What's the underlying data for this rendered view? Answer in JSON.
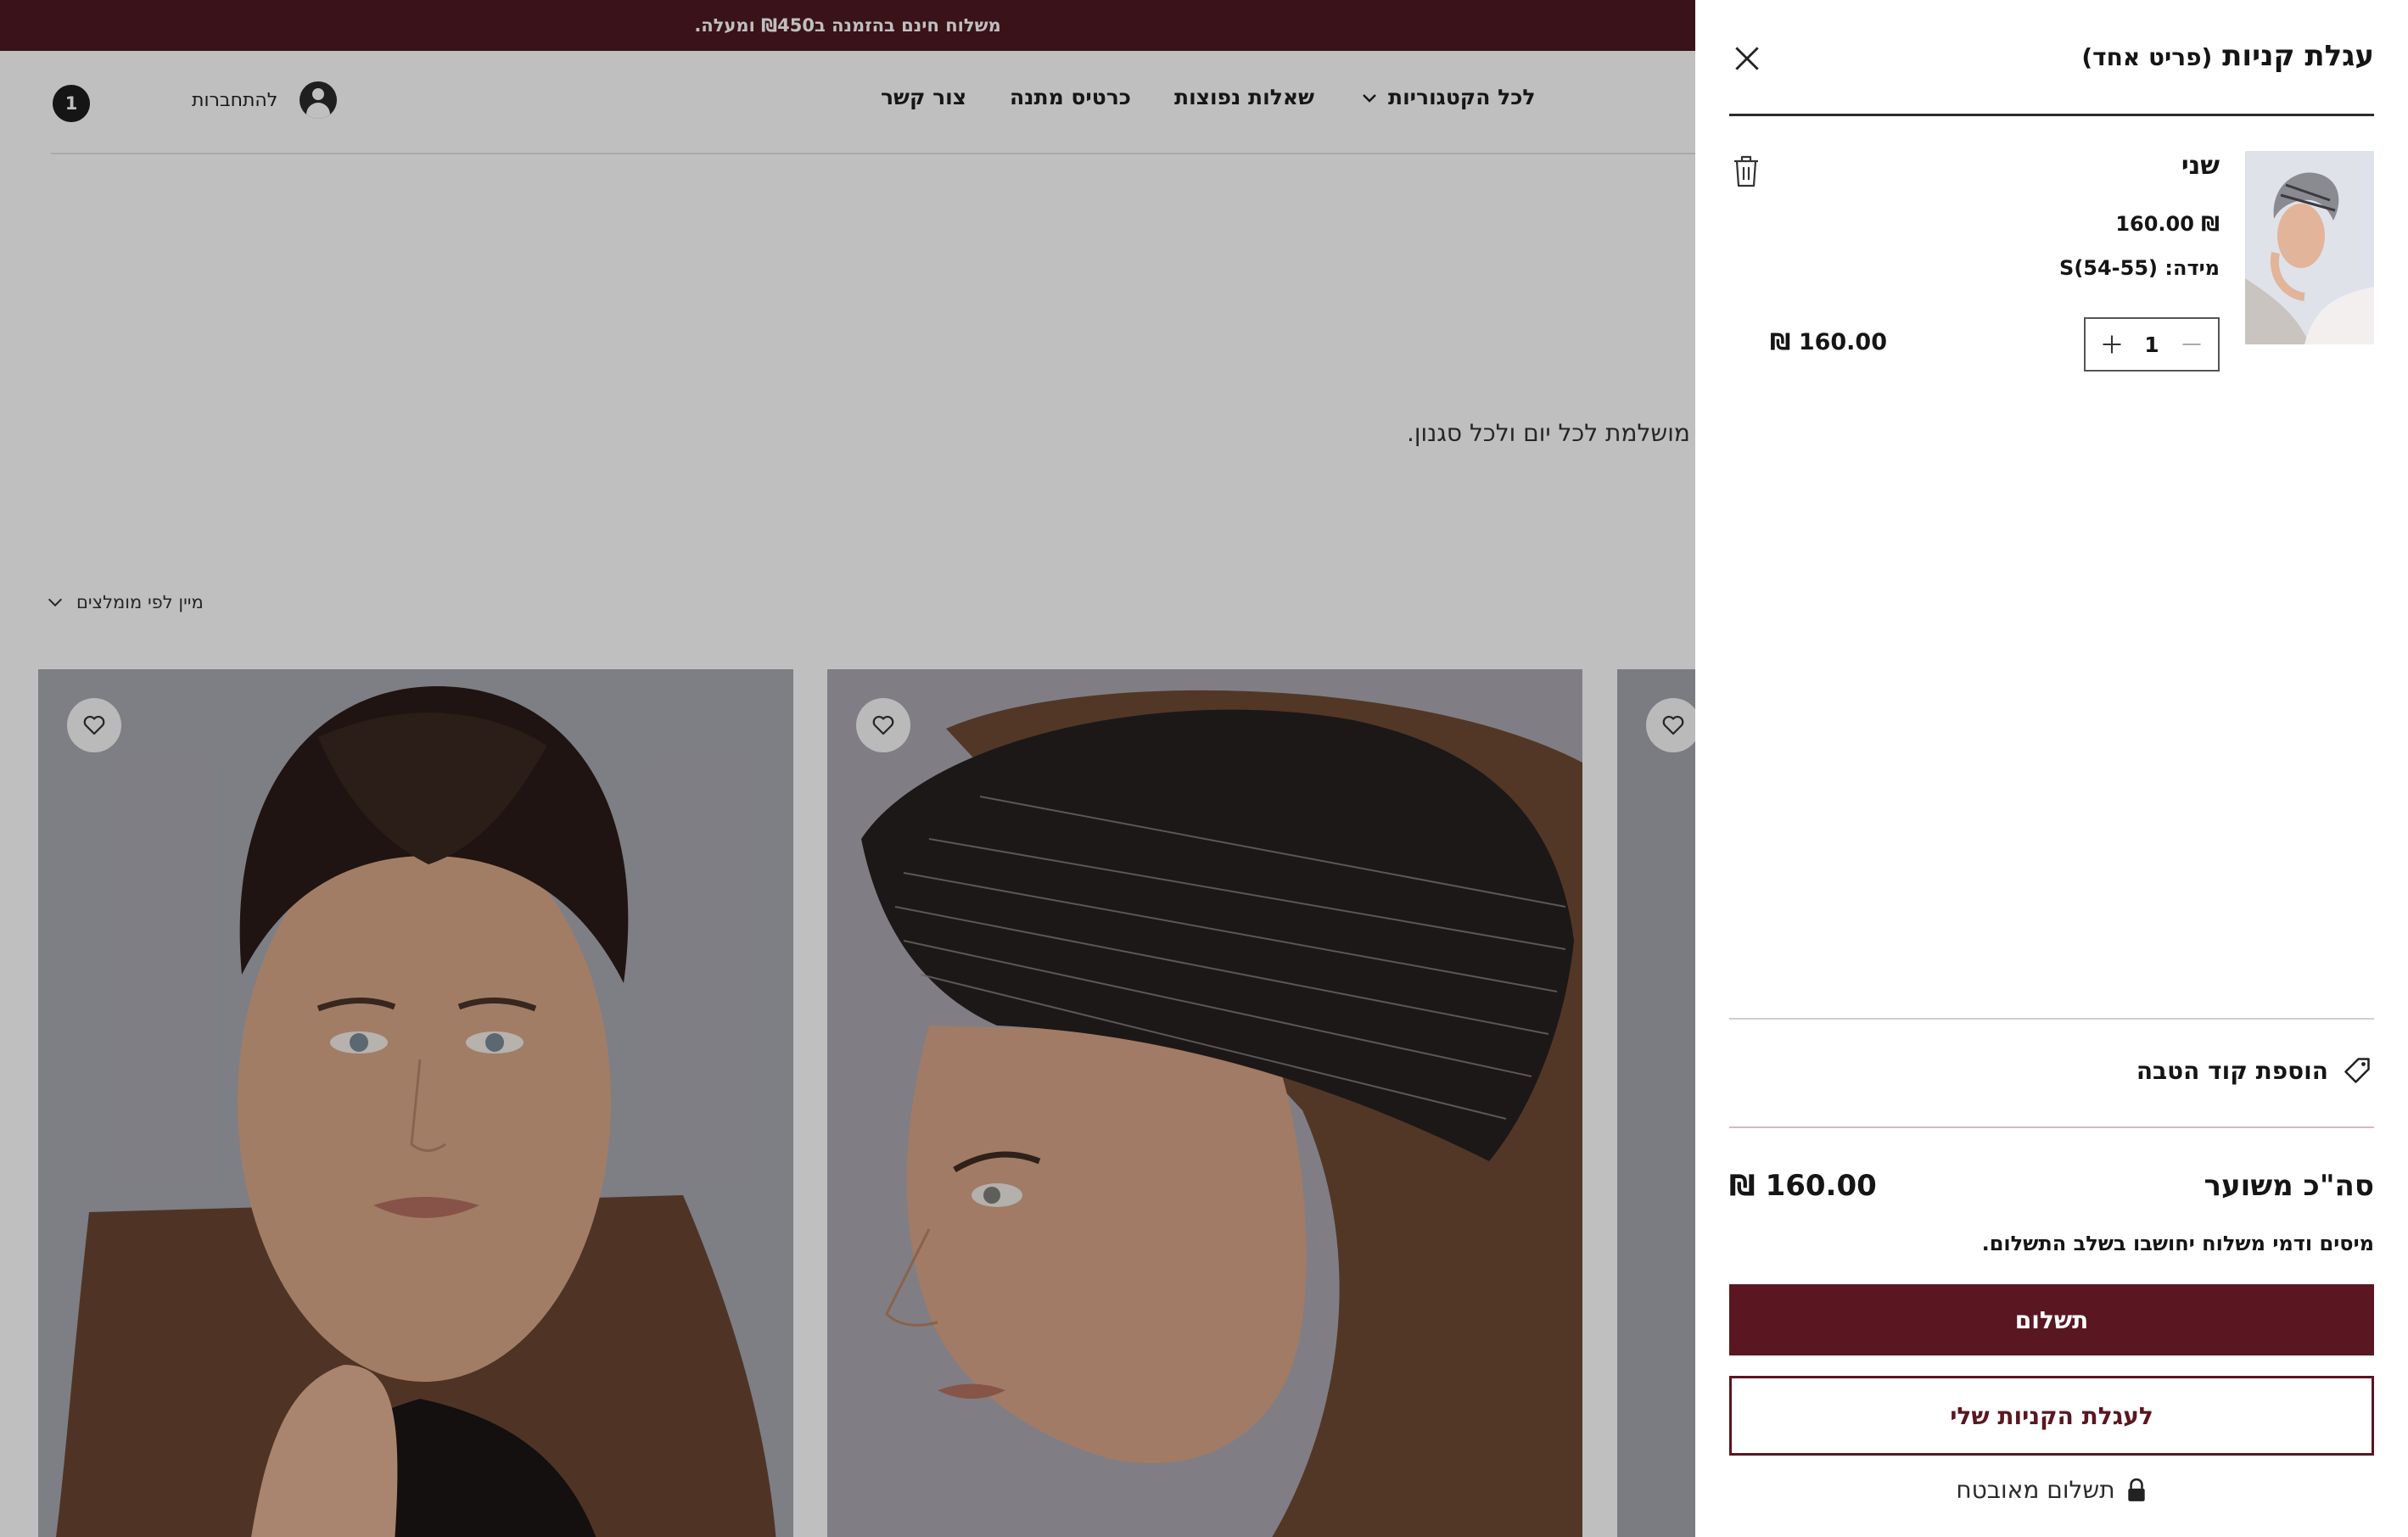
{
  "announcement": "משלוח חינם בהזמנה ב₪450 ומעלה.",
  "header": {
    "cart_count": "1",
    "login_label": "להתחברות",
    "nav": {
      "all_categories": "לכל הקטגוריות",
      "faq": "שאלות נפוצות",
      "gift_card": "כרטיס מתנה",
      "contact": "צור קשר"
    }
  },
  "collection": {
    "description_visible": "ת מושלמת לכל יום ולכל סגנון.",
    "sort_label": "מיין לפי מומלצים"
  },
  "cart": {
    "title": "עגלת קניות",
    "count_text": "(פריט אחד)",
    "item": {
      "name": "שני",
      "price": "₪ 160.00",
      "size": "מידה: S(54-55)",
      "quantity": "1",
      "line_total": "₪ 160.00"
    },
    "promo_label": "הוספת קוד הטבה",
    "subtotal_label": "סה\"כ משוער",
    "subtotal_value": "₪ 160.00",
    "tax_note": "מיסים ודמי משלוח יחושבו בשלב התשלום.",
    "checkout_label": "תשלום",
    "view_cart_label": "לעגלת הקניות שלי",
    "secure_label": "תשלום מאובטח"
  },
  "colors": {
    "brand": "#5a1721",
    "announcement_bg": "#4d1a22",
    "overlay": "rgba(0,0,0,0.25)"
  },
  "icons": [
    "close-icon",
    "trash-icon",
    "plus-icon",
    "minus-icon",
    "tag-icon",
    "lock-icon",
    "heart-icon",
    "chevron-down-icon",
    "user-icon"
  ]
}
